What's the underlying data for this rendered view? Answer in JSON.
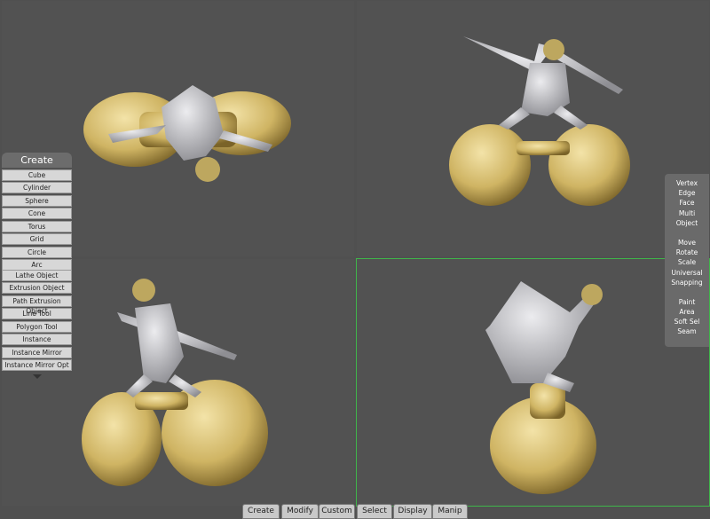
{
  "create_panel": {
    "title": "Create",
    "primitives": [
      "Cube",
      "Cylinder",
      "Sphere",
      "Cone",
      "Torus",
      "Grid",
      "Circle",
      "Arc"
    ],
    "tools": [
      "Lathe Object",
      "Extrusion Object",
      "Path Extrusion Object",
      "Line Tool",
      "Polygon Tool",
      "Instance",
      "Instance Mirror",
      "Instance Mirror Opt"
    ]
  },
  "mode_panel": {
    "selection": [
      "Vertex",
      "Edge",
      "Face",
      "Multi",
      "Object"
    ],
    "transform": [
      "Move",
      "Rotate",
      "Scale",
      "Universal",
      "Snapping"
    ],
    "paint": [
      "Paint",
      "Area",
      "Soft Sel",
      "Seam"
    ]
  },
  "tabs": [
    "Create",
    "Modify",
    "Custom",
    "Select",
    "Display",
    "Manip"
  ],
  "colors": {
    "viewport_bg": "#525252",
    "active_viewport_border": "#3fb54a",
    "model_gold": "#d8c070",
    "model_silver": "#c9c9cc"
  },
  "icons": {
    "more": "triangle-down-icon"
  }
}
